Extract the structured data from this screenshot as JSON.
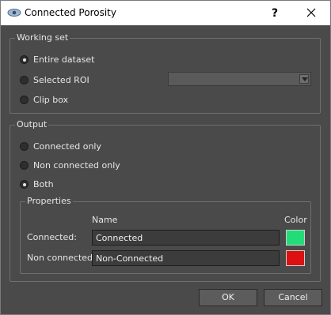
{
  "window": {
    "title": "Connected Porosity",
    "help_label": "?"
  },
  "working_set": {
    "title": "Working set",
    "options": [
      {
        "label": "Entire dataset",
        "checked": true
      },
      {
        "label": "Selected ROI",
        "checked": false
      },
      {
        "label": "Clip box",
        "checked": false
      }
    ],
    "roi_select_value": ""
  },
  "output": {
    "title": "Output",
    "options": [
      {
        "label": "Connected only",
        "checked": false
      },
      {
        "label": "Non connected only",
        "checked": false
      },
      {
        "label": "Both",
        "checked": true
      }
    ],
    "properties": {
      "title": "Properties",
      "name_header": "Name",
      "color_header": "Color",
      "connected": {
        "label": "Connected:",
        "value": "Connected",
        "color": "#22dd77"
      },
      "non_connected": {
        "label": "Non connected:",
        "value": "Non-Connected",
        "color": "#dd1111"
      }
    }
  },
  "buttons": {
    "ok": "OK",
    "cancel": "Cancel"
  }
}
